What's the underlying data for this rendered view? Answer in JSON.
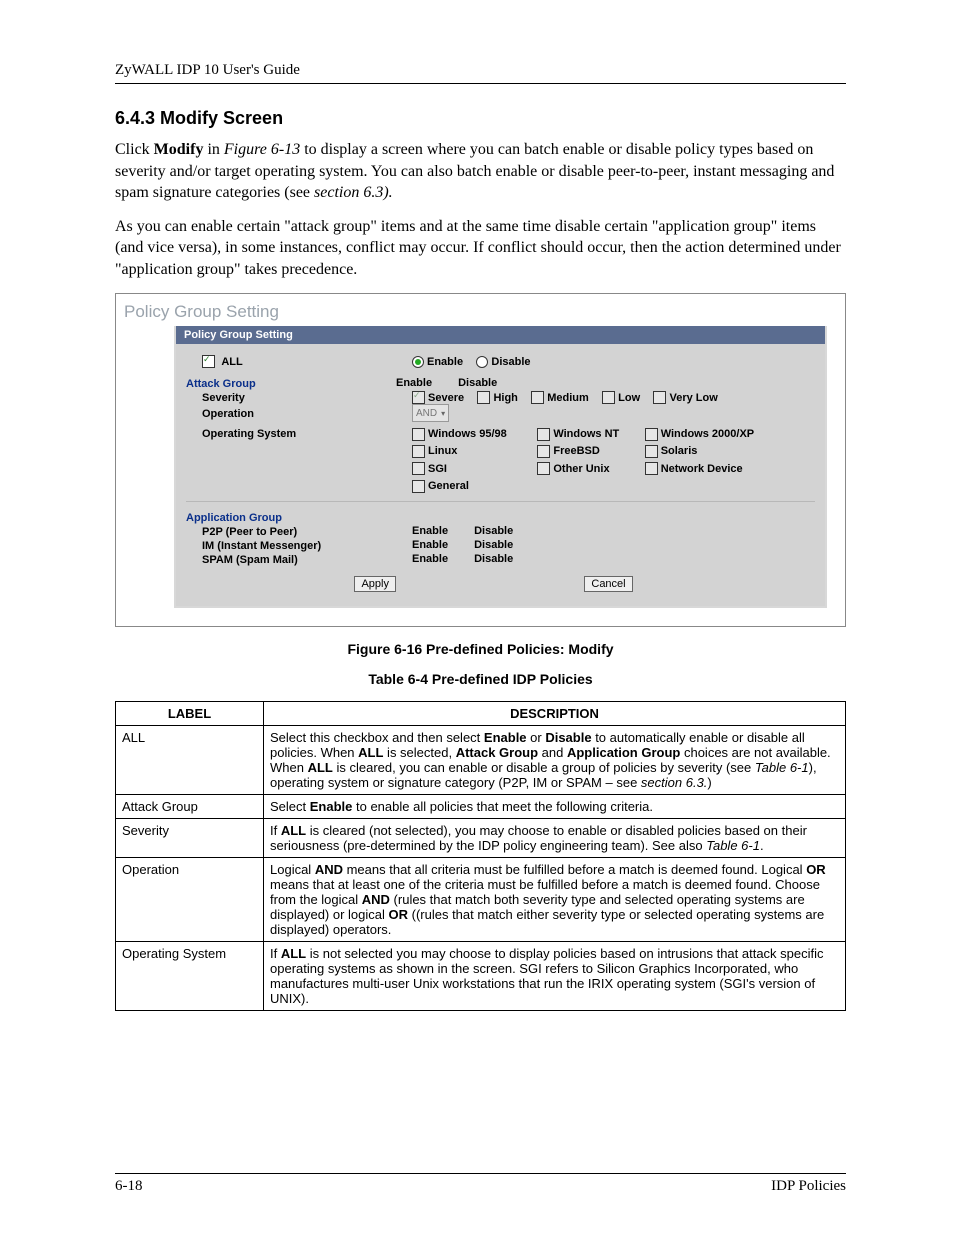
{
  "header": {
    "title": "ZyWALL IDP 10 User's Guide"
  },
  "section": {
    "number": "6.4.3",
    "name": "Modify Screen",
    "title": "6.4.3  Modify Screen"
  },
  "p1": {
    "t1": "Click ",
    "b1": "Modify",
    "t2": " in ",
    "i1": "Figure 6-13",
    "t3": " to display a screen where you can batch enable or disable policy types based on severity and/or target operating system. You can also batch enable or disable peer-to-peer, instant messaging and spam signature categories (see ",
    "i2": "section 6.3).",
    "t4": ""
  },
  "p2": "As you can enable certain \"attack group\" items and at the same time disable certain \"application group\" items (and vice versa), in some instances, conflict may occur. If conflict should occur, then the action determined under \"application group\" takes precedence.",
  "screenshot": {
    "title": "Policy Group Setting",
    "panel_header": "Policy Group Setting",
    "all": "ALL",
    "enable": "Enable",
    "disable": "Disable",
    "attack_group": "Attack Group",
    "severity_lbl": "Severity",
    "operation_lbl": "Operation",
    "os_lbl": "Operating System",
    "sev": {
      "severe": "Severe",
      "high": "High",
      "medium": "Medium",
      "low": "Low",
      "vlow": "Very Low"
    },
    "op_dropdown": "AND",
    "os": {
      "w9598": "Windows 95/98",
      "wnt": "Windows NT",
      "w2kxp": "Windows 2000/XP",
      "linux": "Linux",
      "freebsd": "FreeBSD",
      "solaris": "Solaris",
      "sgi": "SGI",
      "ounix": "Other Unix",
      "netdev": "Network Device",
      "general": "General"
    },
    "app_group": "Application Group",
    "apps": {
      "p2p": "P2P (Peer to Peer)",
      "im": "IM (Instant Messenger)",
      "spam": "SPAM (Spam Mail)"
    },
    "apply": "Apply",
    "cancel": "Cancel"
  },
  "captions": {
    "figure": "Figure 6-16 Pre-defined Policies: Modify",
    "table": "Table 6-4 Pre-defined IDP Policies"
  },
  "table": {
    "h_label": "LABEL",
    "h_desc": "DESCRIPTION",
    "rows": {
      "all": {
        "label": "ALL",
        "d1": "Select this checkbox and then select ",
        "b1": "Enable",
        "d2": " or ",
        "b2": "Disable",
        "d3": " to automatically enable or disable all policies. When ",
        "b3": "ALL",
        "d4": " is selected, ",
        "b4": "Attack Group",
        "d5": " and ",
        "b5": "Application Group",
        "d6": " choices are not available. When ",
        "b6": "ALL",
        "d7": " is cleared, you can enable or disable a group of policies by severity (see ",
        "i1": "Table 6-1",
        "d8": "), operating system or signature category (P2P, IM or SPAM – see ",
        "i2": "section 6.3.",
        "d9": ")"
      },
      "attack": {
        "label": "Attack Group",
        "d1": "Select ",
        "b1": "Enable",
        "d2": " to enable all policies that meet the following criteria."
      },
      "severity": {
        "label": "Severity",
        "d1": "If ",
        "b1": "ALL",
        "d2": " is cleared (not selected), you may choose to enable or disabled policies based on their seriousness (pre-determined by the IDP policy engineering team). See also ",
        "i1": "Table 6-1",
        "d3": "."
      },
      "operation": {
        "label": "Operation",
        "d1": "Logical ",
        "b1": "AND",
        "d2": " means that all criteria must be fulfilled before a match is deemed found. Logical ",
        "b2": "OR",
        "d3": " means that at least one of the criteria must be fulfilled before a match is deemed found. Choose from the logical ",
        "b3": "AND",
        "d4": " (rules that match both severity type and selected operating systems are displayed) or logical ",
        "b4": "OR",
        "d5": " ((rules that match either severity type or selected operating systems are displayed) operators."
      },
      "os": {
        "label": "Operating System",
        "d1": "If ",
        "b1": "ALL",
        "d2": " is not selected you may choose to display policies based on intrusions that attack specific operating systems as shown in the screen. SGI refers to Silicon Graphics Incorporated, who manufactures multi-user Unix workstations that run the IRIX operating system (SGI's version of UNIX)."
      }
    }
  },
  "footer": {
    "page": "6-18",
    "section": "IDP Policies"
  }
}
